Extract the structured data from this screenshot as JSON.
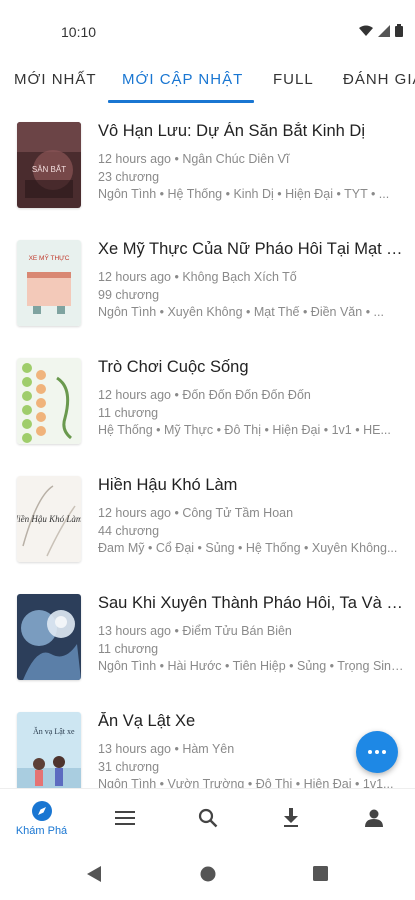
{
  "status_bar": {
    "time": "10:10"
  },
  "tabs": [
    {
      "label": "MỚI NHẤT",
      "active": false
    },
    {
      "label": "MỚI CẬP NHẬT",
      "active": true
    },
    {
      "label": "FULL",
      "active": false
    },
    {
      "label": "ĐÁNH GIÁ",
      "active": false
    }
  ],
  "stories": [
    {
      "title": "Vô Hạn Lưu: Dự Án Săn Bắt Kinh Dị",
      "time": "12 hours ago",
      "author": "Ngân Chúc Diên Vĩ",
      "chapters": "23 chương",
      "tags": "Ngôn Tình • Hệ Thống • Kinh Dị • Hiện Đại • TYT • ..."
    },
    {
      "title": "Xe Mỹ Thực Của Nữ Pháo Hôi Tại Mạt Thế",
      "time": "12 hours ago",
      "author": "Không Bạch Xích Tố",
      "chapters": "99 chương",
      "tags": "Ngôn Tình • Xuyên Không • Mạt Thế • Điền Văn • ..."
    },
    {
      "title": "Trò Chơi Cuộc Sống",
      "time": "12 hours ago",
      "author": "Đốn Đốn Đốn Đốn Đốn",
      "chapters": "11 chương",
      "tags": "Hệ Thống • Mỹ Thực • Đô Thị • Hiện Đại • 1v1 • HE..."
    },
    {
      "title": "Hiền Hậu Khó Làm",
      "time": "12 hours ago",
      "author": "Công Tử Tầm Hoan",
      "chapters": "44 chương",
      "tags": "Đam Mỹ • Cổ Đại • Sủng • Hệ Thống • Xuyên Không..."
    },
    {
      "title": "Sau Khi Xuyên Thành Pháo Hôi, Ta Và Nam Chính HE",
      "time": "13 hours ago",
      "author": "Điểm Tửu Bán Biên",
      "chapters": "11 chương",
      "tags": "Ngôn Tình • Hài Hước • Tiên Hiệp • Sủng • Trọng Sinh..."
    },
    {
      "title": "Ăn Vạ Lật Xe",
      "time": "13 hours ago",
      "author": "Hàm Yên",
      "chapters": "31 chương",
      "tags": "Ngôn Tình • Vườn Trường • Đô Thị • Hiện Đại • 1v1..."
    }
  ],
  "covers": [
    {
      "text": "SĂN BẮT",
      "bg": "#5a3a3a"
    },
    {
      "text": "XE MỸ THỰC",
      "bg": "#eaf2f0"
    },
    {
      "text": "",
      "bg": "#f1f6ee"
    },
    {
      "text": "Hiền Hậu Khó Làm",
      "bg": "#f6f3ef"
    },
    {
      "text": "",
      "bg": "#2c3e5a"
    },
    {
      "text": "Ăn vạ Lật xe",
      "bg": "#cde6f2"
    }
  ],
  "bottom_nav": {
    "explore_label": "Khám Phá"
  },
  "colors": {
    "accent": "#1976d2",
    "fab": "#1e88e5"
  }
}
